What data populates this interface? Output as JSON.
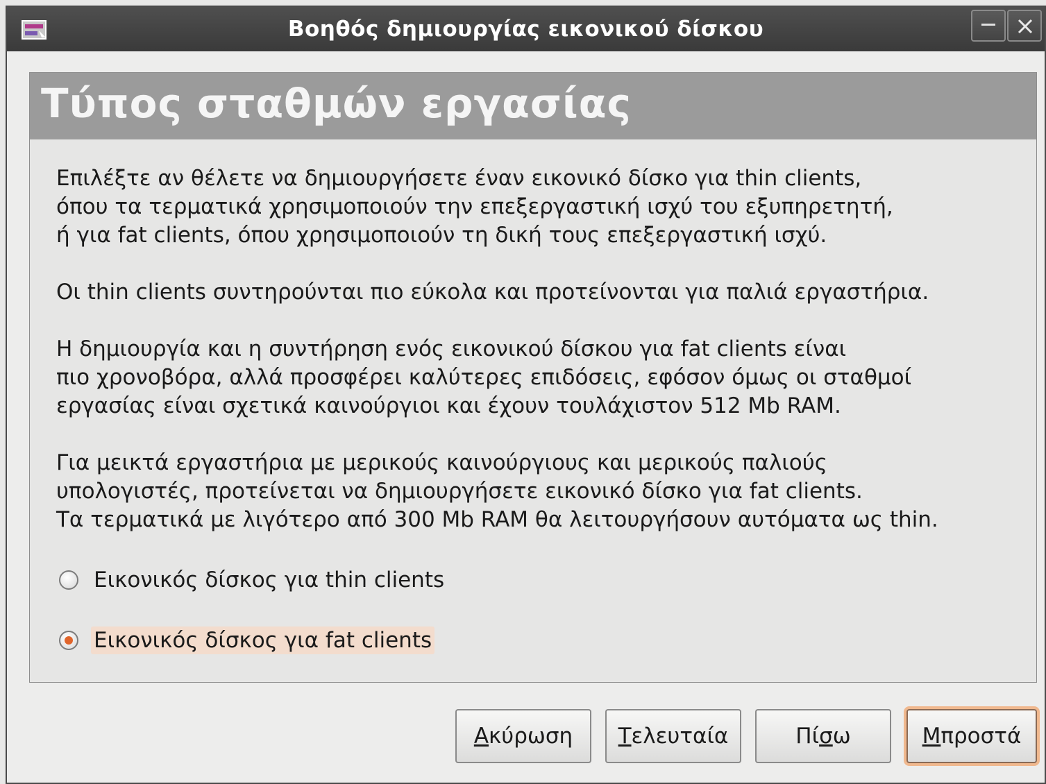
{
  "window": {
    "title": "Βοηθός δημιουργίας εικονικού δίσκου",
    "icon": "wizard-app-icon"
  },
  "page": {
    "title": "Τύπος σταθμών εργασίας",
    "paragraphs": [
      [
        "Επιλέξτε αν θέλετε να δημιουργήσετε έναν εικονικό δίσκο για thin clients,",
        "όπου τα τερματικά χρησιμοποιούν την επεξεργαστική ισχύ του εξυπηρετητή,",
        "ή για fat clients, όπου χρησιμοποιούν τη δική τους επεξεργαστική ισχύ."
      ],
      [
        "Οι thin clients συντηρούνται πιο εύκολα και προτείνονται για παλιά εργαστήρια."
      ],
      [
        "Η δημιουργία και η συντήρηση ενός εικονικού δίσκου για fat clients είναι",
        "πιο χρονοβόρα, αλλά προσφέρει καλύτερες επιδόσεις, εφόσον όμως οι σταθμοί",
        "εργασίας είναι σχετικά καινούργιοι και έχουν τουλάχιστον 512 Mb RAM."
      ],
      [
        "Για μεικτά εργαστήρια με μερικούς καινούργιους και μερικούς παλιούς",
        "υπολογιστές, προτείνεται να δημιουργήσετε εικονικό δίσκο για fat clients.",
        "Τα τερματικά με λιγότερο από 300 Mb RAM θα λειτουργήσουν αυτόματα ως thin."
      ]
    ],
    "options": [
      {
        "label": "Εικονικός δίσκος για thin clients",
        "checked": false
      },
      {
        "label": "Εικονικός δίσκος για fat clients",
        "checked": true
      }
    ]
  },
  "buttons": {
    "cancel": {
      "label": "Ακύρωση",
      "mnemonic": "Α",
      "rest": "κύρωση"
    },
    "last": {
      "label": "Τελευταία",
      "mnemonic": "Τ",
      "rest": "ελευταία"
    },
    "back": {
      "label": "Πίσω",
      "pre": "Πί",
      "mnemonic": "σ",
      "rest": "ω"
    },
    "forward": {
      "label": "Μπροστά",
      "mnemonic": "Μ",
      "rest": "προστά"
    }
  },
  "colors": {
    "accent": "#e0642a",
    "header_band": "#9b9b9b",
    "titlebar": "#3a3a3a"
  }
}
